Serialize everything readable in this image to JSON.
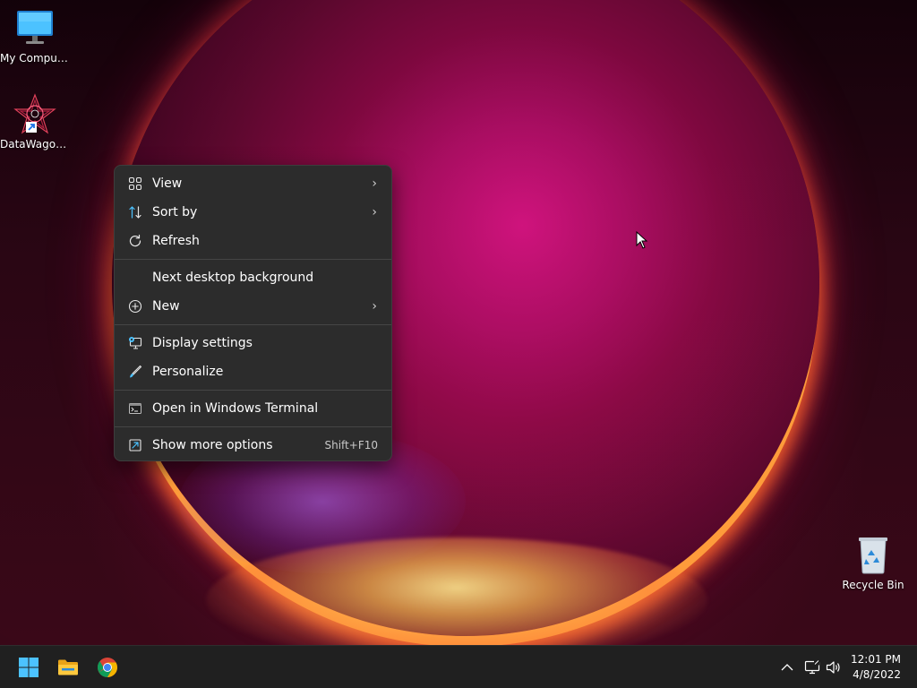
{
  "desktop": {
    "icons": [
      {
        "label": "My Computer",
        "glyph": "monitor-icon"
      },
      {
        "label": "DataWagon...",
        "glyph": "datawagon-icon"
      },
      {
        "label": "Recycle Bin",
        "glyph": "recycle-bin-icon"
      }
    ]
  },
  "context_menu": {
    "items": [
      {
        "label": "View",
        "icon": "grid-icon",
        "submenu": true
      },
      {
        "label": "Sort by",
        "icon": "sort-icon",
        "submenu": true
      },
      {
        "label": "Refresh",
        "icon": "refresh-icon"
      },
      {
        "label": "Next desktop background"
      },
      {
        "label": "New",
        "icon": "plus-circle-icon",
        "submenu": true
      },
      {
        "label": "Display settings",
        "icon": "display-settings-icon"
      },
      {
        "label": "Personalize",
        "icon": "brush-icon"
      },
      {
        "label": "Open in Windows Terminal",
        "icon": "terminal-icon"
      },
      {
        "label": "Show more options",
        "icon": "share-icon",
        "shortcut": "Shift+F10"
      }
    ],
    "chevron": "›"
  },
  "taskbar": {
    "apps": [
      {
        "name": "Start",
        "icon": "windows-start-icon"
      },
      {
        "name": "File Explorer",
        "icon": "folder-icon"
      },
      {
        "name": "Google Chrome",
        "icon": "chrome-icon"
      }
    ],
    "tray": [
      "chevron-up-icon",
      "network-icon",
      "volume-icon"
    ],
    "clock": {
      "time": "12:01 PM",
      "date": "4/8/2022"
    }
  },
  "colors": {
    "menu_bg": "#2c2c2c",
    "taskbar_bg": "#202020",
    "accent_blue": "#4cc2ff"
  }
}
